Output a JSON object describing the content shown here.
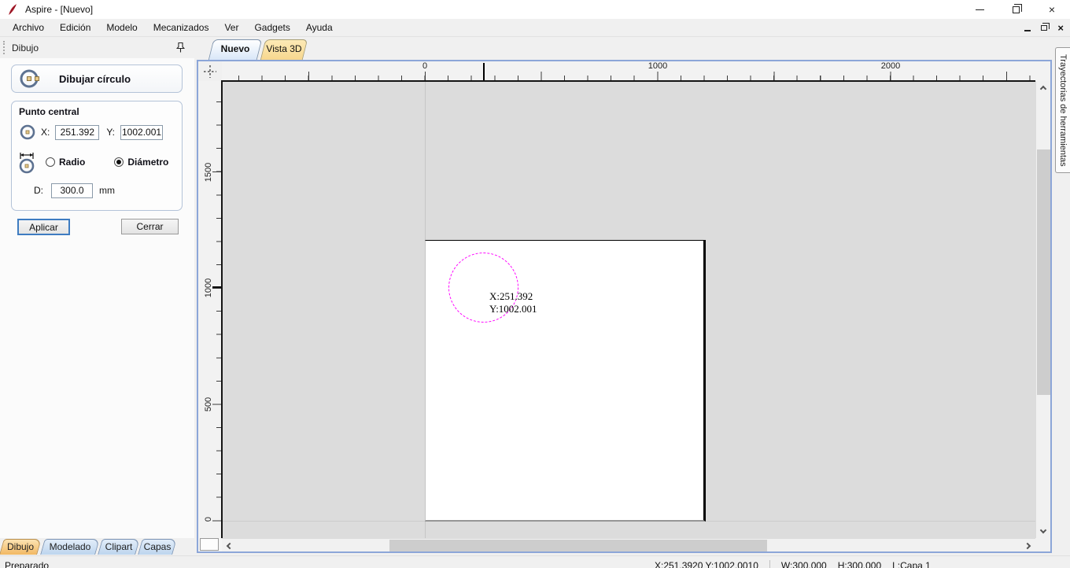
{
  "window": {
    "title": "Aspire - [Nuevo]"
  },
  "menu": {
    "items": [
      "Archivo",
      "Edición",
      "Modelo",
      "Mecanizados",
      "Ver",
      "Gadgets",
      "Ayuda"
    ]
  },
  "panel": {
    "header": "Dibujo",
    "tool_title": "Dibujar círculo",
    "group_title": "Punto central",
    "x_label": "X:",
    "x_value": "251.392",
    "y_label": "Y:",
    "y_value": "1002.001",
    "radius_option": "Radio",
    "diameter_option": "Diámetro",
    "d_label": "D:",
    "d_value": "300.0",
    "d_unit": "mm",
    "apply": "Aplicar",
    "close": "Cerrar",
    "tabs": [
      "Dibujo",
      "Modelado",
      "Clipart",
      "Capas"
    ]
  },
  "canvas": {
    "doc_tabs": [
      "Nuevo",
      "Vista 3D"
    ],
    "ruler_h": [
      "0",
      "1000",
      "2000"
    ],
    "ruler_v": [
      "1500",
      "1000",
      "500",
      "0"
    ],
    "annotation_line1": "X:251.392",
    "annotation_line2": "Y:1002.001"
  },
  "toolpaths_tab": "Trayectorias de herramientas",
  "status": {
    "ready": "Preparado",
    "xy": "X:251.3920 Y:1002.0010",
    "w": "W:300.000",
    "h": "H:300.000",
    "layer": "L:Capa 1"
  },
  "icons": {
    "close_glyph": "×"
  },
  "colors": {
    "frame_blue": "#8ca6d8",
    "circle_magenta": "#ff00ff",
    "active_doc_tab": "#d9e7f8",
    "tab_3d_amber": "#f7d78e",
    "active_left_tab": "#f2b863",
    "apply_focus": "#3e7cc1"
  }
}
